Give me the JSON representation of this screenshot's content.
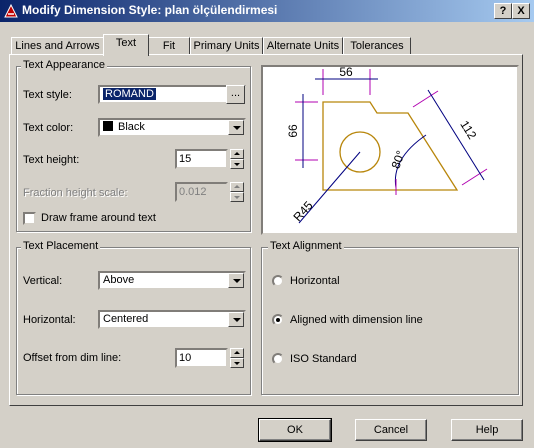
{
  "window": {
    "title": "Modify Dimension Style: plan ölçülendirmesi",
    "help_btn": "?",
    "close_btn": "X"
  },
  "tabs": [
    "Lines and Arrows",
    "Text",
    "Fit",
    "Primary Units",
    "Alternate Units",
    "Tolerances"
  ],
  "text_appearance": {
    "group_label": "Text Appearance",
    "style_label": "Text style:",
    "style_value": "ROMAND",
    "style_browse": "...",
    "color_label": "Text color:",
    "color_value": "Black",
    "height_label": "Text height:",
    "height_value": "15",
    "fraction_label": "Fraction height scale:",
    "fraction_value": "0.012",
    "frame_label": "Draw frame around text"
  },
  "text_placement": {
    "group_label": "Text Placement",
    "vertical_label": "Vertical:",
    "vertical_value": "Above",
    "horizontal_label": "Horizontal:",
    "horizontal_value": "Centered",
    "offset_label": "Offset from dim line:",
    "offset_value": "10"
  },
  "text_alignment": {
    "group_label": "Text Alignment",
    "options": [
      "Horizontal",
      "Aligned with dimension line",
      "ISO Standard"
    ],
    "selected": "Aligned with dimension line"
  },
  "preview": {
    "dim_top": "56",
    "dim_left": "66",
    "dim_right": "112",
    "dim_angle": "80°",
    "dim_radius": "R45",
    "colors": {
      "part": "#b8860b",
      "dim": "#b000b0",
      "dimline": "#000080"
    }
  },
  "buttons": {
    "ok": "OK",
    "cancel": "Cancel",
    "help": "Help"
  }
}
